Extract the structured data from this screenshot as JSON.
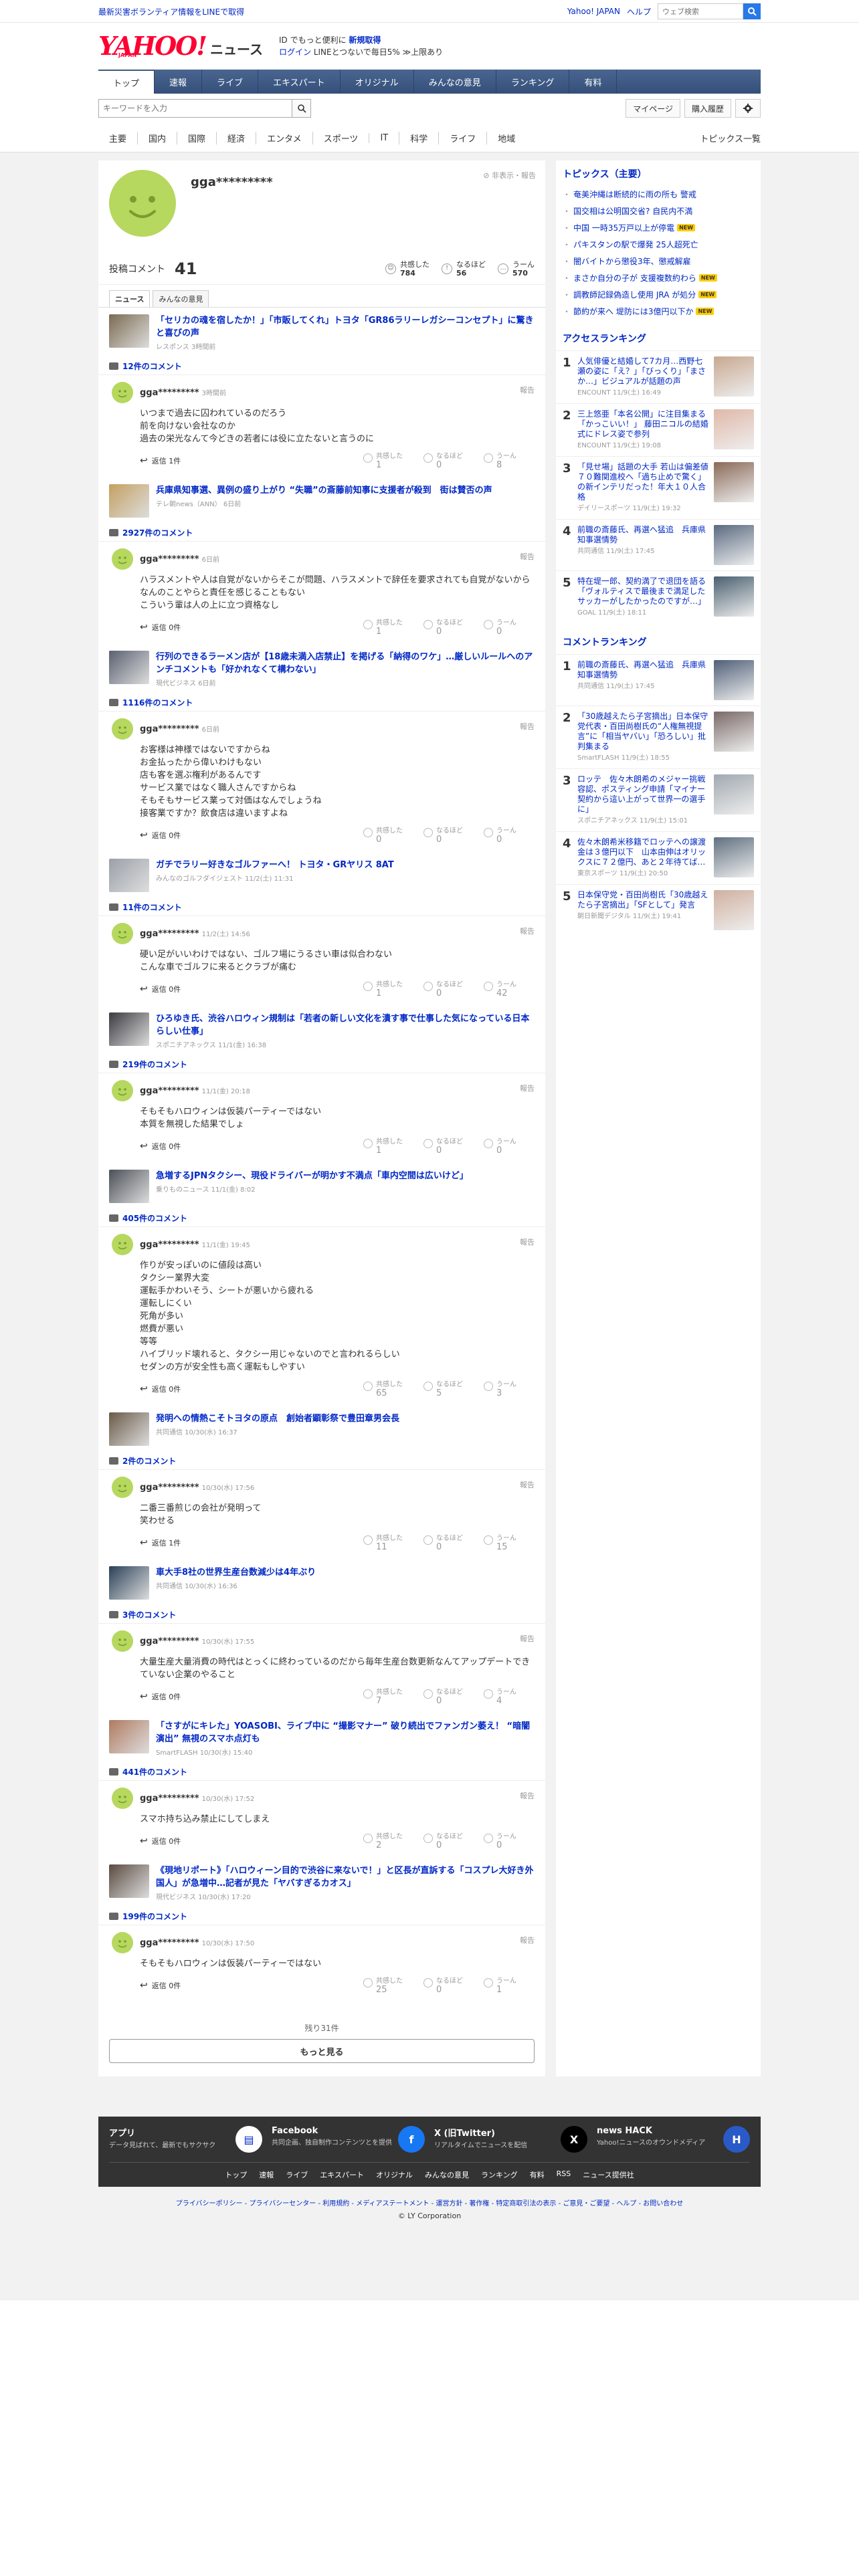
{
  "top": {
    "notice": "最新災害ボランティア情報をLINEで取得",
    "links": [
      "Yahoo! JAPAN",
      "ヘルプ"
    ],
    "search_placeholder": "ウェブ検索"
  },
  "mast": {
    "logo": "YAHOO!",
    "logo_sub": "JAPAN",
    "logo_news": "ニュース",
    "promo1a": "ID でもっと便利に",
    "promo1b": "新規取得",
    "promo2a": "ログイン",
    "promo2b": "LINEとつないで毎日5% ≫上限あり"
  },
  "gnav": [
    "トップ",
    "速報",
    "ライブ",
    "エキスパート",
    "オリジナル",
    "みんなの意見",
    "ランキング",
    "有料"
  ],
  "search": {
    "placeholder": "キーワードを入力",
    "mypage": "マイページ",
    "history": "購入履歴"
  },
  "cnav": [
    "主要",
    "国内",
    "国際",
    "経済",
    "エンタメ",
    "スポーツ",
    "IT",
    "科学",
    "ライフ",
    "地域"
  ],
  "cnav_all": "トピックス一覧",
  "profile": {
    "name": "gga*********",
    "report": "非表示・報告",
    "comments_label": "投稿コメント",
    "comments": "41",
    "r1": "共感した",
    "r1n": "784",
    "r2": "なるほど",
    "r2n": "56",
    "r3": "うーん",
    "r3n": "570"
  },
  "tabs": [
    "ニュース",
    "みんなの意見"
  ],
  "entries": [
    {
      "title": "「セリカの魂を宿したか！」「市販してくれ」トヨタ「GR86ラリーレガシーコンセプト」に驚きと喜びの声",
      "src": "レスポンス 3時間前",
      "count": "12件のコメント",
      "user": "gga*********",
      "time": "3時間前",
      "body": "いつまで過去に囚われているのだろう\n前を向けない会社なのか\n過去の栄光なんて今どきの若者には役に立たないと言うのに",
      "reply": "返信 1件",
      "a": "1",
      "b": "0",
      "c": "8"
    },
    {
      "title": "兵庫県知事選、異例の盛り上がり “失職”の斎藤前知事に支援者が殺到　街は賛否の声",
      "src": "テレ朝news（ANN） 6日前",
      "count": "2927件のコメント",
      "user": "gga*********",
      "time": "6日前",
      "body": "ハラスメントや人は自覚がないからそこが問題、ハラスメントで辞任を要求されても自覚がないからなんのことやらと責任を感じることもない\nこういう輩は人の上に立つ資格なし",
      "reply": "返信 0件",
      "a": "1",
      "b": "0",
      "c": "0"
    },
    {
      "title": "行列のできるラーメン店が【18歳未満入店禁止】を掲げる「納得のワケ」…厳しいルールへのアンチコメントも「好かれなくて構わない」",
      "src": "現代ビジネス 6日前",
      "count": "1116件のコメント",
      "user": "gga*********",
      "time": "6日前",
      "body": "お客様は神様ではないですからね\nお金払ったから偉いわけもない\n店も客を選ぶ権利があるんです\nサービス業ではなく職人さんですからね\nそもそもサービス業って対価はなんでしょうね\n接客業ですか？飲食店は違いますよね",
      "reply": "返信 0件",
      "a": "0",
      "b": "0",
      "c": "0"
    },
    {
      "title": "ガチでラリー好きなゴルファーへ！ トヨタ・GRヤリス 8AT",
      "src": "みんなのゴルフダイジェスト 11/2(土) 11:31",
      "count": "11件のコメント",
      "user": "gga*********",
      "time": "11/2(土) 14:56",
      "body": "硬い足がいいわけではない、ゴルフ場にうるさい車は似合わない\nこんな車でゴルフに来るとクラブが痛む",
      "reply": "返信 0件",
      "a": "1",
      "b": "0",
      "c": "42"
    },
    {
      "title": "ひろゆき氏、渋谷ハロウィン規制は「若者の新しい文化を潰す事で仕事した気になっている日本らしい仕事」",
      "src": "スポニチアネックス 11/1(金) 16:38",
      "count": "219件のコメント",
      "user": "gga*********",
      "time": "11/1(金) 20:18",
      "body": "そもそもハロウィンは仮装パーティーではない\n本質を無視した結果でしょ",
      "reply": "返信 0件",
      "a": "1",
      "b": "0",
      "c": "0"
    },
    {
      "title": "急増するJPNタクシー、現役ドライバーが明かす不満点「車内空間は広いけど」",
      "src": "乗りものニュース 11/1(金) 8:02",
      "count": "405件のコメント",
      "user": "gga*********",
      "time": "11/1(金) 19:45",
      "body": "作りが安っぽいのに値段は高い\nタクシー業界大変\n運転手かわいそう、シートが悪いから疲れる\n運転しにくい\n死角が多い\n燃費が悪い\n等等\nハイブリッド壊れると、タクシー用じゃないのでと言われるらしい\nセダンの方が安全性も高く運転もしやすい",
      "reply": "返信 0件",
      "a": "65",
      "b": "5",
      "c": "3"
    },
    {
      "title": "発明への情熱こそトヨタの原点　創始者顕彰祭で豊田章男会長",
      "src": "共同通信 10/30(水) 16:37",
      "count": "2件のコメント",
      "user": "gga*********",
      "time": "10/30(水) 17:56",
      "body": "二番三番煎じの会社が発明って\n笑わせる",
      "reply": "返信 1件",
      "a": "11",
      "b": "0",
      "c": "15"
    },
    {
      "title": "車大手8社の世界生産台数減少は4年ぶり",
      "src": "共同通信 10/30(水) 16:36",
      "count": "3件のコメント",
      "user": "gga*********",
      "time": "10/30(水) 17:55",
      "body": "大量生産大量消費の時代はとっくに終わっているのだから毎年生産台数更新なんてアップデートできていない企業のやること",
      "reply": "返信 0件",
      "a": "7",
      "b": "0",
      "c": "4"
    },
    {
      "title": "「さすがにキレた」YOASOBI、ライブ中に “撮影マナー” 破り続出でファンガン萎え！ “暗闇演出” 無視のスマホ点灯も",
      "src": "SmartFLASH 10/30(水) 15:40",
      "count": "441件のコメント",
      "user": "gga*********",
      "time": "10/30(水) 17:52",
      "body": "スマホ持ち込み禁止にしてしまえ",
      "reply": "返信 0件",
      "a": "2",
      "b": "0",
      "c": "0"
    },
    {
      "title": "《現地リポート》「ハロウィーン目的で渋谷に来ないで！」と区長が直訴する「コスプレ大好き外国人」が急増中…記者が見た「ヤバすぎるカオス」",
      "src": "現代ビジネス 10/30(水) 17:20",
      "count": "199件のコメント",
      "user": "gga*********",
      "time": "10/30(水) 17:50",
      "body": "そもそもハロウィンは仮装パーティーではない",
      "reply": "返信 0件",
      "a": "25",
      "b": "0",
      "c": "1"
    }
  ],
  "reaction_labels": [
    "共感した",
    "なるほど",
    "うーん"
  ],
  "report": "報告",
  "remain": "残り31件",
  "more": "もっと見る",
  "side": {
    "topics_title": "トピックス（主要）",
    "topics": [
      {
        "t": "奄美沖縄は断続的に雨の所も 警戒",
        "n": ""
      },
      {
        "t": "国交相は公明国交省? 自民内不満",
        "n": ""
      },
      {
        "t": "中国 一時35万戸以上が停電",
        "n": "NEW"
      },
      {
        "t": "パキスタンの駅で爆発 25人超死亡",
        "n": ""
      },
      {
        "t": "闇バイトから懲役3年、懲戒解雇",
        "n": ""
      },
      {
        "t": "まさか自分の子が 支援複数約わら",
        "n": "NEW"
      },
      {
        "t": "調教師記録偽造し使用 JRA が処分",
        "n": "NEW"
      },
      {
        "t": "節約が来へ 堤防には3億円以下か",
        "n": "NEW"
      }
    ],
    "access_title": "アクセスランキング",
    "access": [
      {
        "t": "人気俳優と結婚して7カ月…西野七瀬の姿に「え？」「びっくり」「まさか…」ビジュアルが話題の声",
        "s": "ENCOUNT 11/9(土) 16:49"
      },
      {
        "t": "三上悠亜「本名公開」に注目集まる「かっこいい！」 藤田ニコルの結婚式にドレス姿で参列",
        "s": "ENCOUNT 11/9(土) 19:08"
      },
      {
        "t": "「見せ場」話題の大手 若山は偏差値７０難関進校へ「過ち止めで驚く」の新インテリだった！年大１０人合格",
        "s": "デイリースポーツ 11/9(土) 19:32"
      },
      {
        "t": "前職の斎藤氏、再選へ猛追　兵庫県知事選情勢",
        "s": "共同通信 11/9(土) 17:45"
      },
      {
        "t": "特在堤一郎、契約満了で退団を語る「ヴォルティスで最後まで満足したサッカーがしたかったのですが…」",
        "s": "GOAL 11/9(土) 18:11"
      }
    ],
    "comment_title": "コメントランキング",
    "comment": [
      {
        "t": "前職の斎藤氏、再選へ猛追　兵庫県知事選情勢",
        "s": "共同通信 11/9(土) 17:45"
      },
      {
        "t": "「30歳越えたら子宮摘出」日本保守党代表・百田尚樹氏の“人権無視提言”に「相当ヤバい」「恐ろしい」批判集まる",
        "s": "SmartFLASH 11/9(土) 18:55"
      },
      {
        "t": "ロッテ　佐々木朗希のメジャー挑戦容認、ポスティング申請「マイナー契約から這い上がって世界一の選手に」",
        "s": "スポニチアネックス 11/9(土) 15:01"
      },
      {
        "t": "佐々木朗希米移籍でロッテへの譲渡金は３億円以下　山本由伸はオリックスに７２億円、あと２年待てば…",
        "s": "東京スポーツ 11/9(土) 20:50"
      },
      {
        "t": "日本保守党・百田尚樹氏「30歳越えたら子宮摘出」「SFとして」発言",
        "s": "朝日新聞デジタル 11/9(土) 19:41"
      }
    ]
  },
  "footer": {
    "cols": [
      {
        "t": "アプリ",
        "d": "データ見ばれて、最新でもサクサク"
      },
      {
        "t": "Facebook",
        "d": "共同企画、独自制作コンテンツとを提供"
      },
      {
        "t": "X (旧Twitter)",
        "d": "リアルタイムでニュースを配信"
      },
      {
        "t": "news HACK",
        "d": "Yahoo!ニュースのオウンドメディア"
      }
    ],
    "nav": [
      "トップ",
      "速報",
      "ライブ",
      "エキスパート",
      "オリジナル",
      "みんなの意見",
      "ランキング",
      "有料",
      "RSS",
      "ニュース提供社"
    ],
    "links": "プライバシーポリシー - プライバシーセンター - 利用規約 - メディアステートメント - 運営方針 - 著作権 - 特定商取引法の表示 - ご意見・ご要望 - ヘルプ - お問い合わせ",
    "copy": "© LY Corporation"
  },
  "colors": {
    "link": "#0028c6",
    "nav": "#3d5a80",
    "avatar": "#b6d85e",
    "brand": "#ff0033"
  }
}
